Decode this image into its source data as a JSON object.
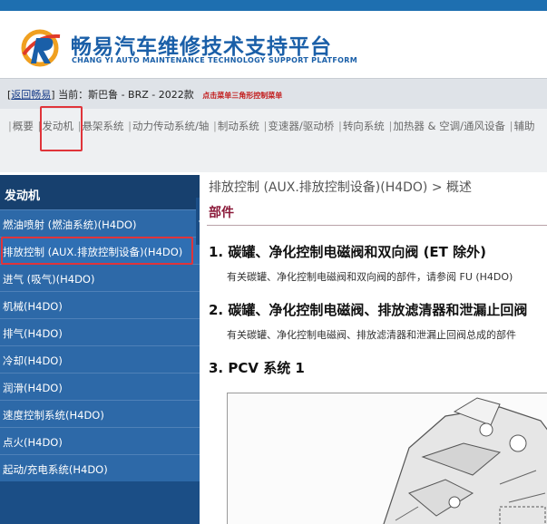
{
  "header": {
    "brand_title": "畅易汽车维修技术支持平台",
    "brand_subtitle": "CHANG YI AUTO MAINTENANCE TECHNOLOGY SUPPORT PLATFORM"
  },
  "infobar": {
    "back_link": "返回畅易",
    "current_label": "当前：",
    "vehicle": "斯巴鲁 - BRZ - 2022款",
    "hint": "点击菜单三角形控制菜单"
  },
  "nav": {
    "items": [
      "概要",
      "发动机",
      "悬架系统",
      "动力传动系统/轴",
      "制动系统",
      "变速器/驱动桥",
      "转向系统",
      "加热器 & 空调/通风设备",
      "辅助"
    ]
  },
  "sidebar": {
    "title": "发动机",
    "items": [
      "燃油喷射 (燃油系统)(H4DO)",
      "排放控制 (AUX.排放控制设备)(H4DO)",
      "进气 (吸气)(H4DO)",
      "机械(H4DO)",
      "排气(H4DO)",
      "冷却(H4DO)",
      "润滑(H4DO)",
      "速度控制系统(H4DO)",
      "点火(H4DO)",
      "起动/充电系统(H4DO)"
    ]
  },
  "content": {
    "breadcrumb": "排放控制 (AUX.排放控制设备)(H4DO) > 概述",
    "section": "部件",
    "headings": [
      "1. 碳罐、净化控制电磁阀和双向阀 (ET 除外)",
      "2. 碳罐、净化控制电磁阀、排放滤清器和泄漏止回阀",
      "3. PCV 系统 1"
    ],
    "paragraphs": [
      "有关碳罐、净化控制电磁阀和双向阀的部件，请参阅 FU (H4DO)",
      "有关碳罐、净化控制电磁阀、排放滤清器和泄漏止回阀总成的部件"
    ]
  },
  "colors": {
    "brand_blue": "#1a5fa8",
    "sidebar_bg": "#1b4e86",
    "sidebar_item": "#2d69a8",
    "highlight_red": "#e0343a",
    "section_red": "#8b1a3a"
  }
}
